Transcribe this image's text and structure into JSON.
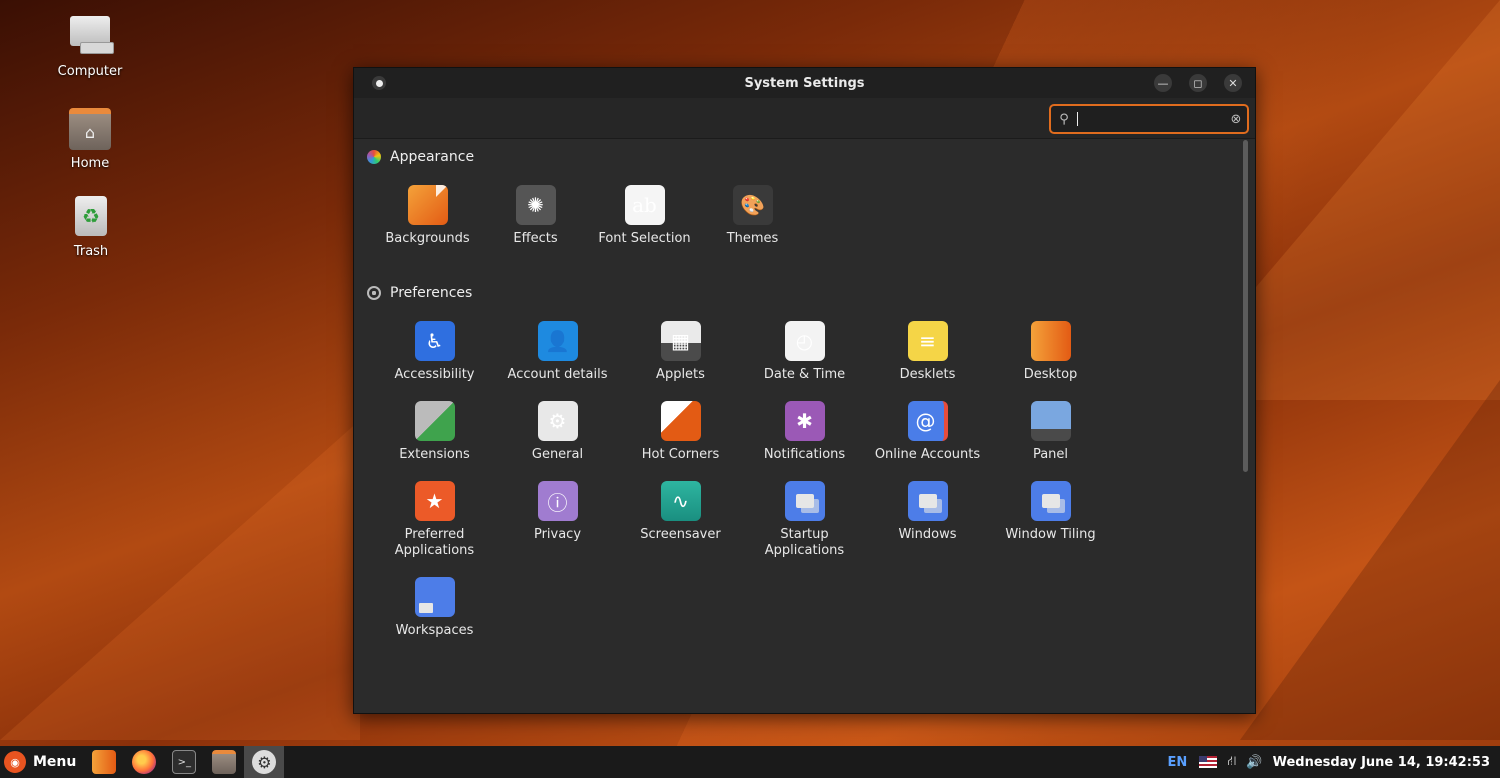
{
  "desktop": {
    "icons": [
      {
        "label": "Computer"
      },
      {
        "label": "Home"
      },
      {
        "label": "Trash"
      }
    ]
  },
  "window": {
    "title": "System Settings",
    "search": {
      "value": "",
      "placeholder": ""
    }
  },
  "sections": {
    "appearance": {
      "title": "Appearance",
      "items": [
        {
          "label": "Backgrounds",
          "icon": "backgrounds-icon"
        },
        {
          "label": "Effects",
          "icon": "effects-icon"
        },
        {
          "label": "Font Selection",
          "icon": "font-selection-icon"
        },
        {
          "label": "Themes",
          "icon": "themes-icon"
        }
      ]
    },
    "preferences": {
      "title": "Preferences",
      "items": [
        {
          "label": "Accessibility",
          "icon": "accessibility-icon"
        },
        {
          "label": "Account details",
          "icon": "account-details-icon"
        },
        {
          "label": "Applets",
          "icon": "applets-icon"
        },
        {
          "label": "Date & Time",
          "icon": "date-time-icon"
        },
        {
          "label": "Desklets",
          "icon": "desklets-icon"
        },
        {
          "label": "Desktop",
          "icon": "desktop-icon"
        },
        {
          "label": "Extensions",
          "icon": "extensions-icon"
        },
        {
          "label": "General",
          "icon": "general-icon"
        },
        {
          "label": "Hot Corners",
          "icon": "hot-corners-icon"
        },
        {
          "label": "Notifications",
          "icon": "notifications-icon"
        },
        {
          "label": "Online Accounts",
          "icon": "online-accounts-icon"
        },
        {
          "label": "Panel",
          "icon": "panel-icon"
        },
        {
          "label": "Preferred Applications",
          "icon": "preferred-applications-icon"
        },
        {
          "label": "Privacy",
          "icon": "privacy-icon"
        },
        {
          "label": "Screensaver",
          "icon": "screensaver-icon"
        },
        {
          "label": "Startup Applications",
          "icon": "startup-applications-icon"
        },
        {
          "label": "Windows",
          "icon": "windows-icon"
        },
        {
          "label": "Window Tiling",
          "icon": "window-tiling-icon"
        },
        {
          "label": "Workspaces",
          "icon": "workspaces-icon"
        }
      ]
    }
  },
  "taskbar": {
    "menu_label": "Menu",
    "apps": [
      {
        "name": "files-app-icon"
      },
      {
        "name": "firefox-icon"
      },
      {
        "name": "terminal-icon"
      },
      {
        "name": "file-manager-icon"
      },
      {
        "name": "system-settings-icon"
      }
    ],
    "tray": {
      "language": "EN",
      "clock": "Wednesday June 14, 19:42:53"
    }
  },
  "colors": {
    "accent": "#e06c1e",
    "window_bg": "#2b2b2b",
    "taskbar_bg": "#1a1a1a"
  }
}
